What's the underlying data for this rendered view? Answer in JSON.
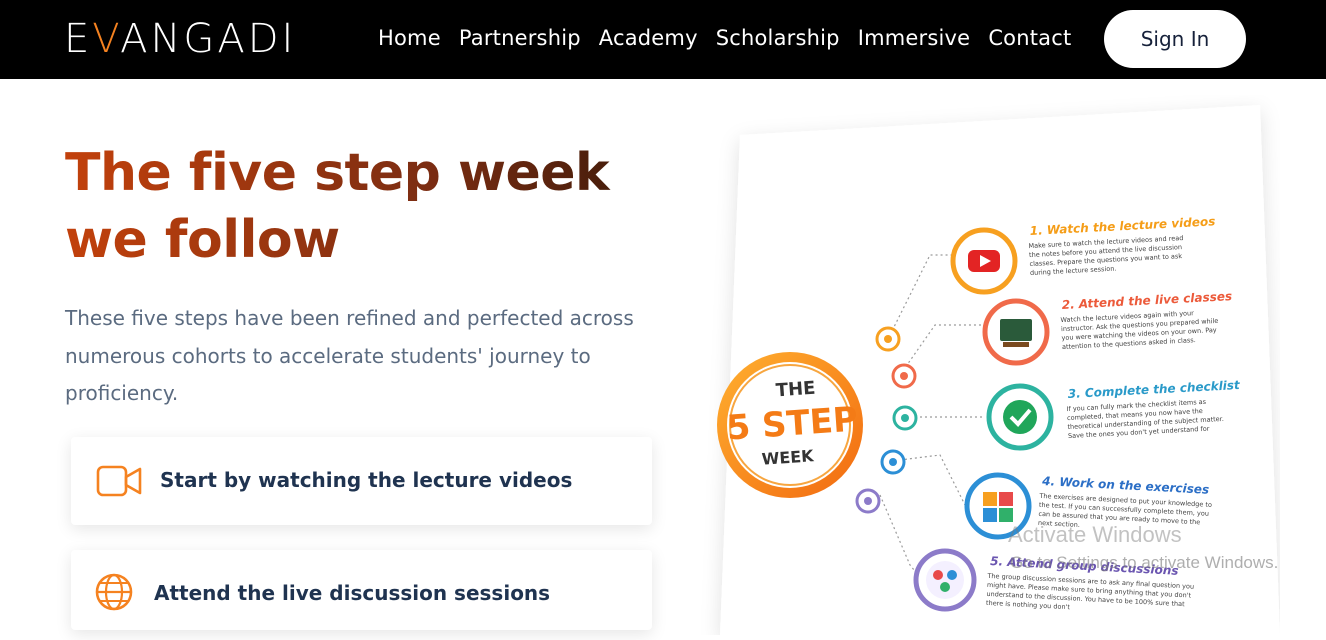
{
  "nav": {
    "logo_prefix": "E",
    "logo_v": "V",
    "logo_suffix": "ANGADI",
    "items": [
      "Home",
      "Partnership",
      "Academy",
      "Scholarship",
      "Immersive",
      "Contact"
    ],
    "signin_label": "Sign In"
  },
  "hero": {
    "title_line1": "The five step week",
    "title_line2": "we follow",
    "description": "These five steps have been refined and perfected across numerous cohorts to accelerate students' journey to proficiency."
  },
  "cards": [
    {
      "label": "Start by watching the lecture videos",
      "icon": "video-camera-icon"
    },
    {
      "label": "Attend the live discussion sessions",
      "icon": "globe-icon"
    }
  ],
  "poster": {
    "badge_line1": "THE",
    "badge_line2": "5 STEP",
    "badge_line3": "WEEK",
    "steps": [
      {
        "title": "1. Watch the lecture videos",
        "body1": "Make sure to watch the lecture videos and read",
        "body2": "the notes before you attend the live discussion",
        "body3": "classes. Prepare the questions you want to ask",
        "body4": "during the lecture session."
      },
      {
        "title": "2. Attend the live classes",
        "body1": "Watch the lecture videos again with your",
        "body2": "instructor. Ask the questions you prepared while",
        "body3": "you were watching the videos on your own. Pay",
        "body4": "attention to the questions asked in class."
      },
      {
        "title": "3. Complete the checklist",
        "body1": "If you can fully mark the checklist items as",
        "body2": "completed, that means you now have the",
        "body3": "theoretical understanding of the subject matter.",
        "body4": "Save the ones you don't yet understand for"
      },
      {
        "title": "4. Work on the exercises",
        "body1": "The exercises are designed to put your knowledge to",
        "body2": "the test. If you can successfully complete them, you",
        "body3": "can be assured that you are ready to move to the",
        "body4": "next section."
      },
      {
        "title": "5. Attend group discussions",
        "body1": "The group discussion sessions are to ask any final question you",
        "body2": "might have. Please make sure to bring anything that you don't",
        "body3": "understand to the discussion. You have to be 100% sure that",
        "body4": "there is nothing you don't"
      }
    ]
  },
  "watermark": {
    "line1": "Activate Windows",
    "line2": "Go to Settings to activate Windows."
  },
  "colors": {
    "accent_orange": "#f58220",
    "title_start": "#c2410c",
    "title_end": "#3b1a0a",
    "nav_bg": "#000000",
    "card_text": "#1f3350"
  }
}
